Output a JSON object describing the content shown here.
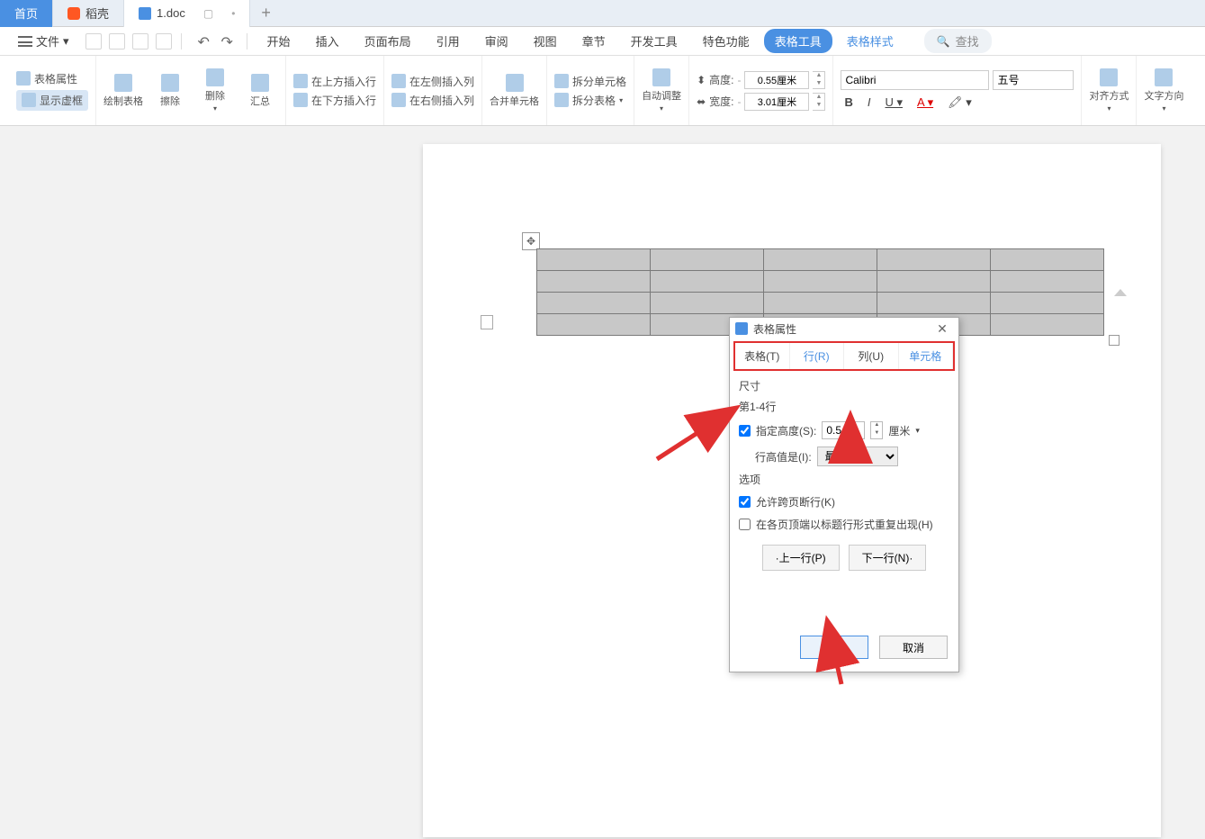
{
  "tabs": {
    "home": "首页",
    "daoke": "稻壳",
    "doc": "1.doc"
  },
  "file_menu": "文件",
  "menus": [
    "开始",
    "插入",
    "页面布局",
    "引用",
    "审阅",
    "视图",
    "章节",
    "开发工具",
    "特色功能"
  ],
  "menu_active": "表格工具",
  "menu_link": "表格样式",
  "search_placeholder": "查找",
  "ribbon": {
    "table_props": "表格属性",
    "show_grid": "显示虚框",
    "draw_table": "绘制表格",
    "eraser": "擦除",
    "delete": "删除",
    "summary": "汇总",
    "insert_above": "在上方插入行",
    "insert_below": "在下方插入行",
    "insert_left": "在左侧插入列",
    "insert_right": "在右侧插入列",
    "merge": "合并单元格",
    "split_cells": "拆分单元格",
    "split_table": "拆分表格",
    "autofit": "自动调整",
    "height_label": "高度:",
    "width_label": "宽度:",
    "height_value": "0.55厘米",
    "width_value": "3.01厘米",
    "font_name": "Calibri",
    "font_size": "五号",
    "align": "对齐方式",
    "text_dir": "文字方向"
  },
  "dialog": {
    "title": "表格属性",
    "tabs": [
      "表格(T)",
      "行(R)",
      "列(U)",
      "单元格"
    ],
    "size_section": "尺寸",
    "row_range": "第1-4行",
    "spec_height": "指定高度(S):",
    "height_value": "0.5",
    "height_unit": "厘米",
    "row_height_is": "行高值是(I):",
    "row_height_mode": "最小值",
    "options_section": "选项",
    "allow_break": "允许跨页断行(K)",
    "repeat_header": "在各页顶端以标题行形式重复出现(H)",
    "prev_row": "·上一行(P)",
    "next_row": "下一行(N)·",
    "ok": "确定",
    "cancel": "取消"
  }
}
